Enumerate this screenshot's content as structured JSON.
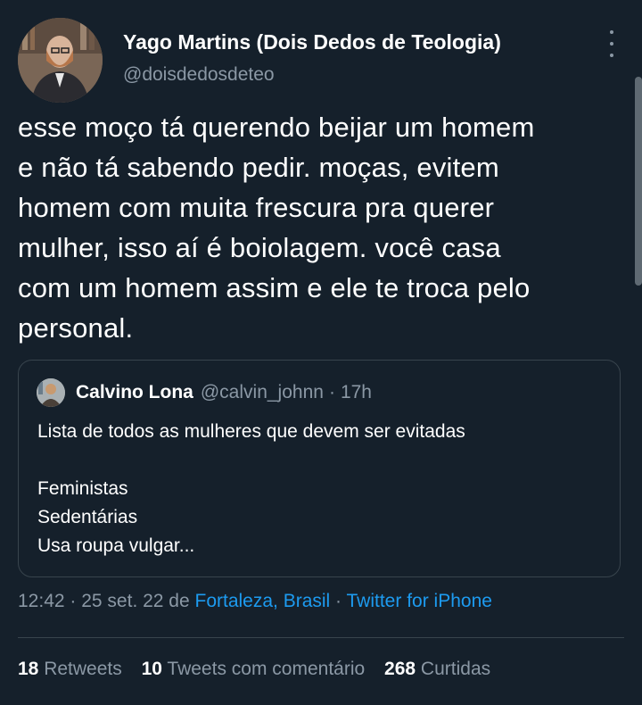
{
  "author": {
    "name": "Yago Martins (Dois Dedos de Teologia)",
    "handle": "@doisdedosdeteo"
  },
  "tweet": {
    "text": "esse moço tá querendo beijar um homem\ne não tá sabendo pedir. moças, evitem\nhomem com muita frescura pra querer\nmulher, isso aí é boiolagem. você casa\ncom um homem assim e ele te troca pelo\npersonal."
  },
  "quoted": {
    "name": "Calvino Lona",
    "handle": "@calvin_johnn",
    "separator": "·",
    "time": "17h",
    "text": "Lista de todos as mulheres que devem ser evitadas\n\nFeministas\nSedentárias\nUsa roupa vulgar..."
  },
  "meta": {
    "time": "12:42",
    "sep1": " · ",
    "date": "25 set. 22",
    "de": " de ",
    "location": "Fortaleza, Brasil",
    "sep2": " · ",
    "source": "Twitter for iPhone"
  },
  "stats": {
    "retweets_count": "18",
    "retweets_label": "Retweets",
    "quotes_count": "10",
    "quotes_label": "Tweets com comentário",
    "likes_count": "268",
    "likes_label": "Curtidas"
  },
  "colors": {
    "background": "#15202b",
    "secondary_text": "#8b98a5",
    "link": "#1d9bf0",
    "border": "#38444d"
  },
  "icons": [
    "more-vertical-icon"
  ]
}
